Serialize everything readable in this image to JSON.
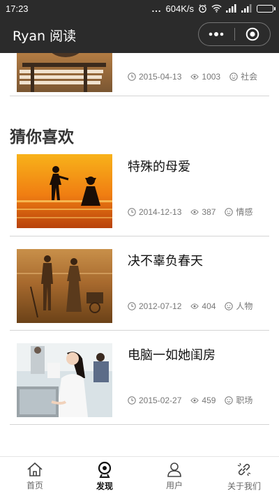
{
  "status_bar": {
    "time": "17:23",
    "dots": "...",
    "network_speed": "604K/s"
  },
  "header": {
    "title": "Ryan 阅读"
  },
  "top_article": {
    "date": "2015-04-13",
    "views": "1003",
    "category": "社会"
  },
  "section": {
    "title": "猜你喜欢"
  },
  "articles": [
    {
      "title": "特殊的母爱",
      "date": "2014-12-13",
      "views": "387",
      "category": "情感"
    },
    {
      "title": "决不辜负春天",
      "date": "2012-07-12",
      "views": "404",
      "category": "人物"
    },
    {
      "title": "电脑一如她闺房",
      "date": "2015-02-27",
      "views": "459",
      "category": "职场"
    }
  ],
  "tabs": [
    {
      "label": "首页",
      "icon": "home-icon"
    },
    {
      "label": "发现",
      "icon": "discover-icon"
    },
    {
      "label": "用户",
      "icon": "user-icon"
    },
    {
      "label": "关于我们",
      "icon": "link-icon"
    }
  ],
  "active_tab": "发现",
  "colors": {
    "header_bg": "#2b2b2b",
    "divider": "#d4d4d4",
    "meta_text": "#777777"
  }
}
